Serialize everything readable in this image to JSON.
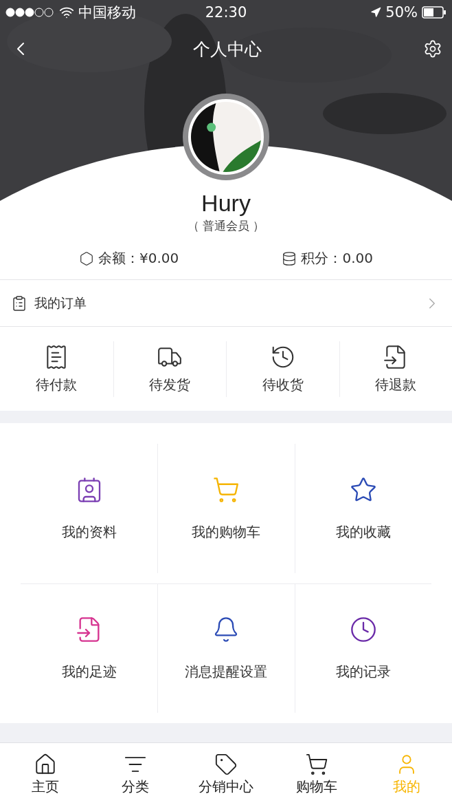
{
  "status_bar": {
    "carrier": "中国移动",
    "time": "22:30",
    "battery": "50%"
  },
  "nav": {
    "title": "个人中心"
  },
  "profile": {
    "name": "Hury",
    "level": "（ 普通会员 ）"
  },
  "stats": [
    {
      "label": "余额：¥0.00"
    },
    {
      "label": "积分：0.00"
    }
  ],
  "orders": {
    "title": "我的订单",
    "statuses": [
      {
        "label": "待付款"
      },
      {
        "label": "待发货"
      },
      {
        "label": "待收货"
      },
      {
        "label": "待退款"
      }
    ]
  },
  "grid": [
    {
      "label": "我的资料",
      "color": "#7b3fb3"
    },
    {
      "label": "我的购物车",
      "color": "#f5b400"
    },
    {
      "label": "我的收藏",
      "color": "#2b4bb5"
    },
    {
      "label": "我的足迹",
      "color": "#d63390"
    },
    {
      "label": "消息提醒设置",
      "color": "#2b4bb5"
    },
    {
      "label": "我的记录",
      "color": "#6a2aa8"
    }
  ],
  "tab_bar": [
    {
      "label": "主页",
      "selected": false
    },
    {
      "label": "分类",
      "selected": false
    },
    {
      "label": "分销中心",
      "selected": false
    },
    {
      "label": "购物车",
      "selected": false
    },
    {
      "label": "我的",
      "selected": true
    }
  ]
}
